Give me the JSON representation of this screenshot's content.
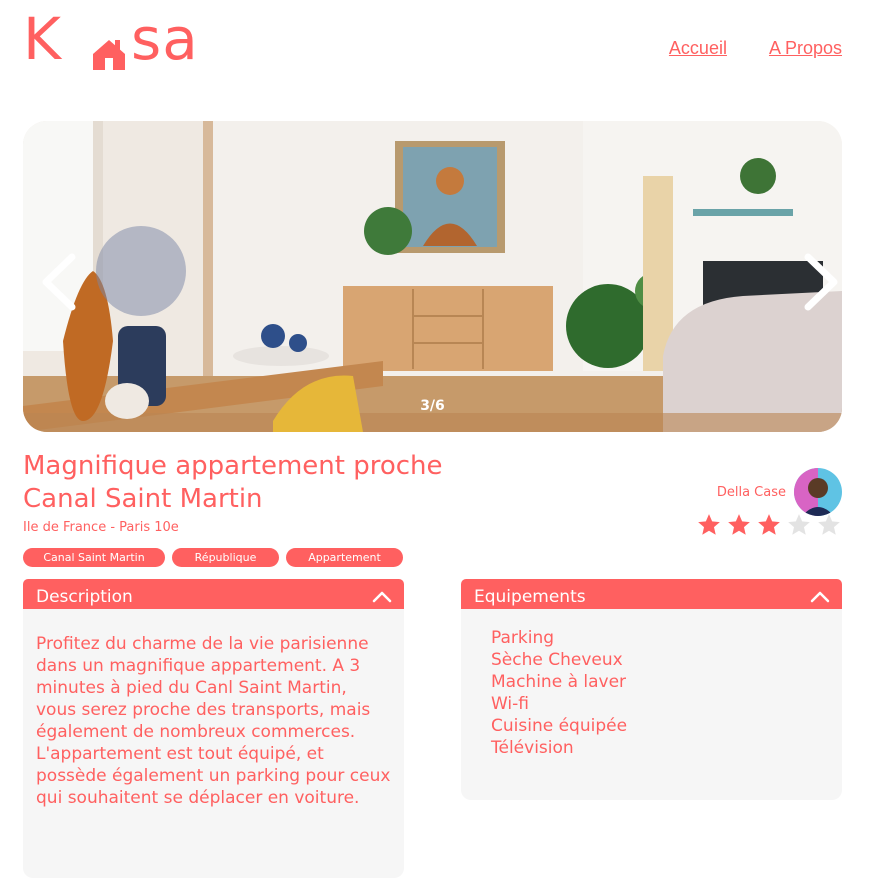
{
  "logo": {
    "left": "K",
    "right": "sa"
  },
  "nav": {
    "home": "Accueil",
    "about": "A Propos"
  },
  "carousel": {
    "counter": "3/6",
    "prev_icon": "chevron-left-icon",
    "next_icon": "chevron-right-icon"
  },
  "listing": {
    "title": "Magnifique appartement proche Canal Saint Martin",
    "location": "Ile de France - Paris 10e",
    "tags": [
      "Canal Saint Martin",
      "République",
      "Appartement"
    ],
    "host": {
      "name": "Della Case"
    },
    "rating": 3,
    "rating_max": 5
  },
  "description": {
    "title": "Description",
    "text": "Profitez du charme de la vie parisienne dans un magnifique appartement. A 3 minutes à pied du Canl Saint Martin, vous serez proche des transports, mais également de nombreux commerces. L'appartement est tout équipé, et possède également un parking pour ceux qui souhaitent se déplacer en voiture."
  },
  "equipments": {
    "title": "Equipements",
    "items": [
      "Parking",
      "Sèche Cheveux",
      "Machine à laver",
      "Wi-fi",
      "Cuisine équipée",
      "Télévision"
    ]
  },
  "colors": {
    "accent": "#FF6060",
    "panel_bg": "#F6F6F6"
  }
}
